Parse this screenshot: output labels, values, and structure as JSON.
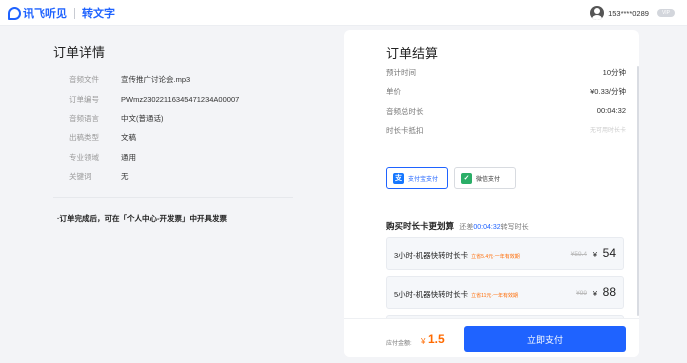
{
  "header": {
    "brand": "讯飞听见",
    "section": "转文字",
    "phone": "153****0289",
    "badge": "VIP"
  },
  "detail": {
    "title": "订单详情",
    "rows": [
      {
        "label": "音频文件",
        "value": "宣传推广讨论会.mp3"
      },
      {
        "label": "订单编号",
        "value": "PWmz23022116345471234A00007"
      },
      {
        "label": "音频语言",
        "value": "中文(普通话)"
      },
      {
        "label": "出稿类型",
        "value": "文稿"
      },
      {
        "label": "专业领域",
        "value": "通用"
      },
      {
        "label": "关键词",
        "value": "无"
      }
    ],
    "note": "·订单完成后，可在「个人中心-开发票」中开具发票"
  },
  "settlement": {
    "title": "订单结算",
    "rows": [
      {
        "label": "预计时间",
        "value": "10分钟"
      },
      {
        "label": "单价",
        "value": "¥0.33/分钟"
      },
      {
        "label": "音频总时长",
        "value": "00:04:32"
      },
      {
        "label": "时长卡抵扣",
        "value": "无可用时长卡"
      }
    ],
    "payments": [
      {
        "label": "支付宝支付",
        "icon": "alipay-icon"
      },
      {
        "label": "微信支付",
        "icon": "wechat-icon"
      }
    ],
    "cards_title": "购买时长卡更划算",
    "cards_hint_pre": "还差",
    "cards_hint_time": "00:04:32",
    "cards_hint_post": "转写时长",
    "cards": [
      {
        "name": "3小时-机器快转时长卡",
        "promo": "立省5.4元·一年有效期",
        "old_price": "¥59.4",
        "yen": "¥",
        "price": "54"
      },
      {
        "name": "5小时-机器快转时长卡",
        "promo": "立省11元·一年有效期",
        "old_price": "¥99",
        "yen": "¥",
        "price": "88"
      }
    ],
    "amount_label": "应付金额:",
    "amount_symbol": "¥",
    "amount": "1.5",
    "pay_button": "立即支付"
  },
  "colors": {
    "accent": "#1f63ff",
    "price": "#ff6a00",
    "wechat": "#2aae67"
  }
}
